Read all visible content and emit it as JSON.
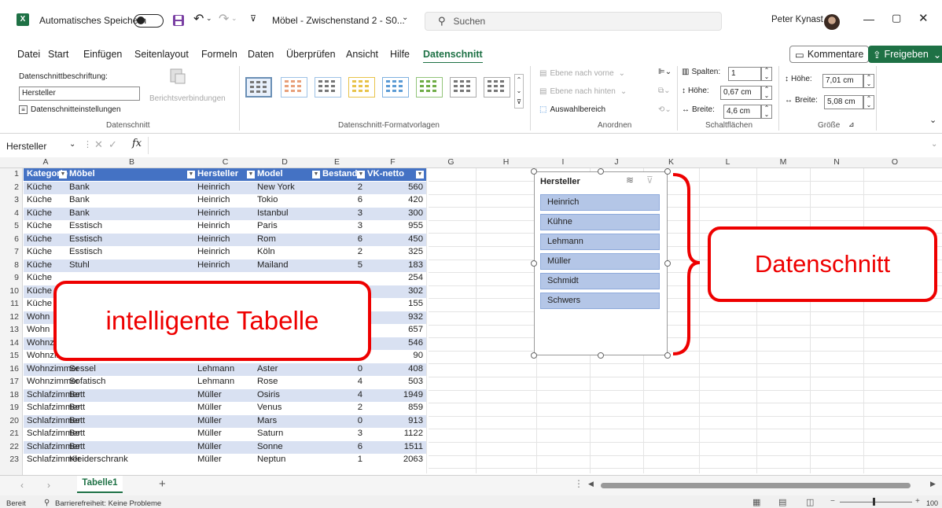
{
  "titlebar": {
    "autosave_label": "Automatisches Speichern",
    "filename": "Möbel - Zwischenstand 2 - S0...",
    "search_placeholder": "Suchen",
    "user_name": "Peter Kynast"
  },
  "menu": {
    "items": [
      "Datei",
      "Start",
      "Einfügen",
      "Seitenlayout",
      "Formeln",
      "Daten",
      "Überprüfen",
      "Ansicht",
      "Hilfe",
      "Datenschnitt"
    ],
    "comments_label": "Kommentare",
    "share_label": "Freigeben"
  },
  "ribbon": {
    "caption_label": "Datenschnittbeschriftung:",
    "caption_value": "Hersteller",
    "report_connections": "Berichtsverbindungen",
    "slicer_settings": "Datenschnitteinstellungen",
    "group_slicer": "Datenschnitt",
    "group_styles": "Datenschnitt-Formatvorlagen",
    "bring_forward": "Ebene nach vorne",
    "send_backward": "Ebene nach hinten",
    "selection_pane": "Auswahlbereich",
    "group_arrange": "Anordnen",
    "columns_label": "Spalten:",
    "columns_value": "1",
    "btn_height_label": "Höhe:",
    "btn_height_value": "0,67 cm",
    "btn_width_label": "Breite:",
    "btn_width_value": "4,6 cm",
    "group_buttons": "Schaltflächen",
    "height_label": "Höhe:",
    "height_value": "7,01 cm",
    "width_label": "Breite:",
    "width_value": "5,08 cm",
    "group_size": "Größe"
  },
  "formula_bar": {
    "name_box": "Hersteller",
    "fx": "fx"
  },
  "columns": [
    "A",
    "B",
    "C",
    "D",
    "E",
    "F",
    "G",
    "H",
    "I",
    "J",
    "K",
    "L",
    "M",
    "N",
    "O"
  ],
  "table": {
    "headers": [
      "Kategorie",
      "Möbel",
      "Hersteller",
      "Model",
      "Bestand",
      "VK-netto"
    ],
    "rows": [
      [
        "Küche",
        "Bank",
        "Heinrich",
        "New York",
        "2",
        "560"
      ],
      [
        "Küche",
        "Bank",
        "Heinrich",
        "Tokio",
        "6",
        "420"
      ],
      [
        "Küche",
        "Bank",
        "Heinrich",
        "Istanbul",
        "3",
        "300"
      ],
      [
        "Küche",
        "Esstisch",
        "Heinrich",
        "Paris",
        "3",
        "955"
      ],
      [
        "Küche",
        "Esstisch",
        "Heinrich",
        "Rom",
        "6",
        "450"
      ],
      [
        "Küche",
        "Esstisch",
        "Heinrich",
        "Köln",
        "2",
        "325"
      ],
      [
        "Küche",
        "Stuhl",
        "Heinrich",
        "Mailand",
        "5",
        "183"
      ],
      [
        "Küche",
        "",
        "",
        "",
        "",
        "254"
      ],
      [
        "Küche",
        "",
        "",
        "",
        "",
        "302"
      ],
      [
        "Küche",
        "",
        "",
        "",
        "",
        "155"
      ],
      [
        "Wohn",
        "",
        "",
        "",
        "",
        "932"
      ],
      [
        "Wohn",
        "",
        "",
        "",
        "",
        "657"
      ],
      [
        "Wohnz",
        "",
        "",
        "",
        "",
        "546"
      ],
      [
        "Wohnzimmer",
        "Fernsehtisch",
        "Lehmann",
        "Nelke",
        "6",
        "90"
      ],
      [
        "Wohnzimmer",
        "Sessel",
        "Lehmann",
        "Aster",
        "0",
        "408"
      ],
      [
        "Wohnzimmer",
        "Sofatisch",
        "Lehmann",
        "Rose",
        "4",
        "503"
      ],
      [
        "Schlafzimmer",
        "Bett",
        "Müller",
        "Osiris",
        "4",
        "1949"
      ],
      [
        "Schlafzimmer",
        "Bett",
        "Müller",
        "Venus",
        "2",
        "859"
      ],
      [
        "Schlafzimmer",
        "Bett",
        "Müller",
        "Mars",
        "0",
        "913"
      ],
      [
        "Schlafzimmer",
        "Bett",
        "Müller",
        "Saturn",
        "3",
        "1122"
      ],
      [
        "Schlafzimmer",
        "Bett",
        "Müller",
        "Sonne",
        "6",
        "1511"
      ],
      [
        "Schlafzimmer",
        "Kleiderschrank",
        "Müller",
        "Neptun",
        "1",
        "2063"
      ]
    ]
  },
  "slicer": {
    "title": "Hersteller",
    "items": [
      "Heinrich",
      "Kühne",
      "Lehmann",
      "Müller",
      "Schmidt",
      "Schwers"
    ]
  },
  "callouts": {
    "table": "intelligente Tabelle",
    "slicer": "Datenschnitt"
  },
  "sheet_tab": "Tabelle1",
  "status": {
    "ready": "Bereit",
    "accessibility": "Barrierefreiheit: Keine Probleme",
    "zoom": "100 %"
  },
  "colors": {
    "excel_green": "#1e7145",
    "table_header": "#4472c4",
    "table_band": "#d9e1f2",
    "slicer_item": "#b4c6e7",
    "callout_red": "#ee0000"
  }
}
